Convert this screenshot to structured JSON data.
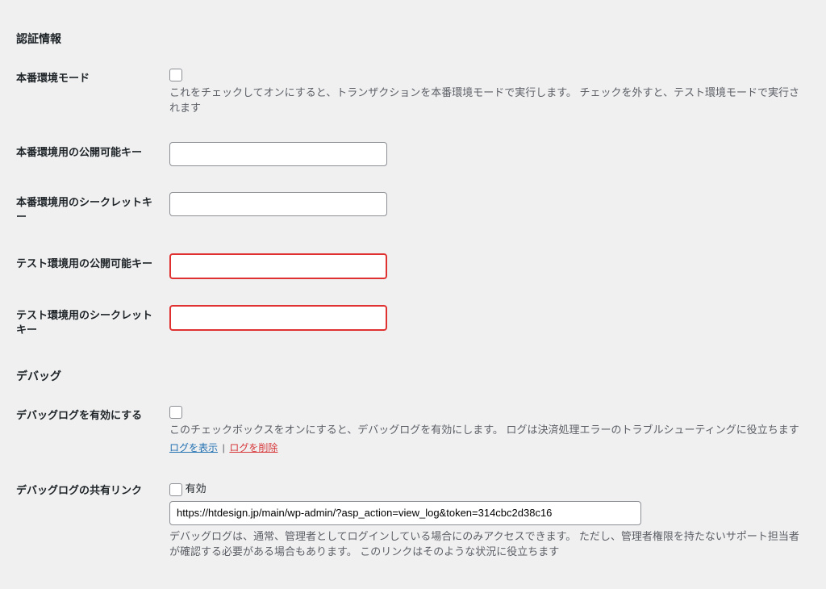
{
  "sections": {
    "auth": {
      "heading": "認証情報",
      "live_mode": {
        "label": "本番環境モード",
        "description": "これをチェックしてオンにすると、トランザクションを本番環境モードで実行します。 チェックを外すと、テスト環境モードで実行されます"
      },
      "live_pk": {
        "label": "本番環境用の公開可能キー",
        "value": ""
      },
      "live_sk": {
        "label": "本番環境用のシークレットキー",
        "value": ""
      },
      "test_pk": {
        "label": "テスト環境用の公開可能キー",
        "value": ""
      },
      "test_sk": {
        "label": "テスト環境用のシークレットキー",
        "value": ""
      }
    },
    "debug": {
      "heading": "デバッグ",
      "enable_log": {
        "label": "デバッグログを有効にする",
        "description": "このチェックボックスをオンにすると、デバッグログを有効にします。 ログは決済処理エラーのトラブルシューティングに役立ちます",
        "show_link": "ログを表示",
        "delete_link": "ログを削除",
        "separator": "|"
      },
      "share_link": {
        "label": "デバッグログの共有リンク",
        "enable_label": "有効",
        "url": "https://htdesign.jp/main/wp-admin/?asp_action=view_log&token=314cbc2d38c16",
        "description": "デバッグログは、通常、管理者としてログインしている場合にのみアクセスできます。 ただし、管理者権限を持たないサポート担当者が確認する必要がある場合もあります。 このリンクはそのような状況に役立ちます"
      }
    }
  }
}
